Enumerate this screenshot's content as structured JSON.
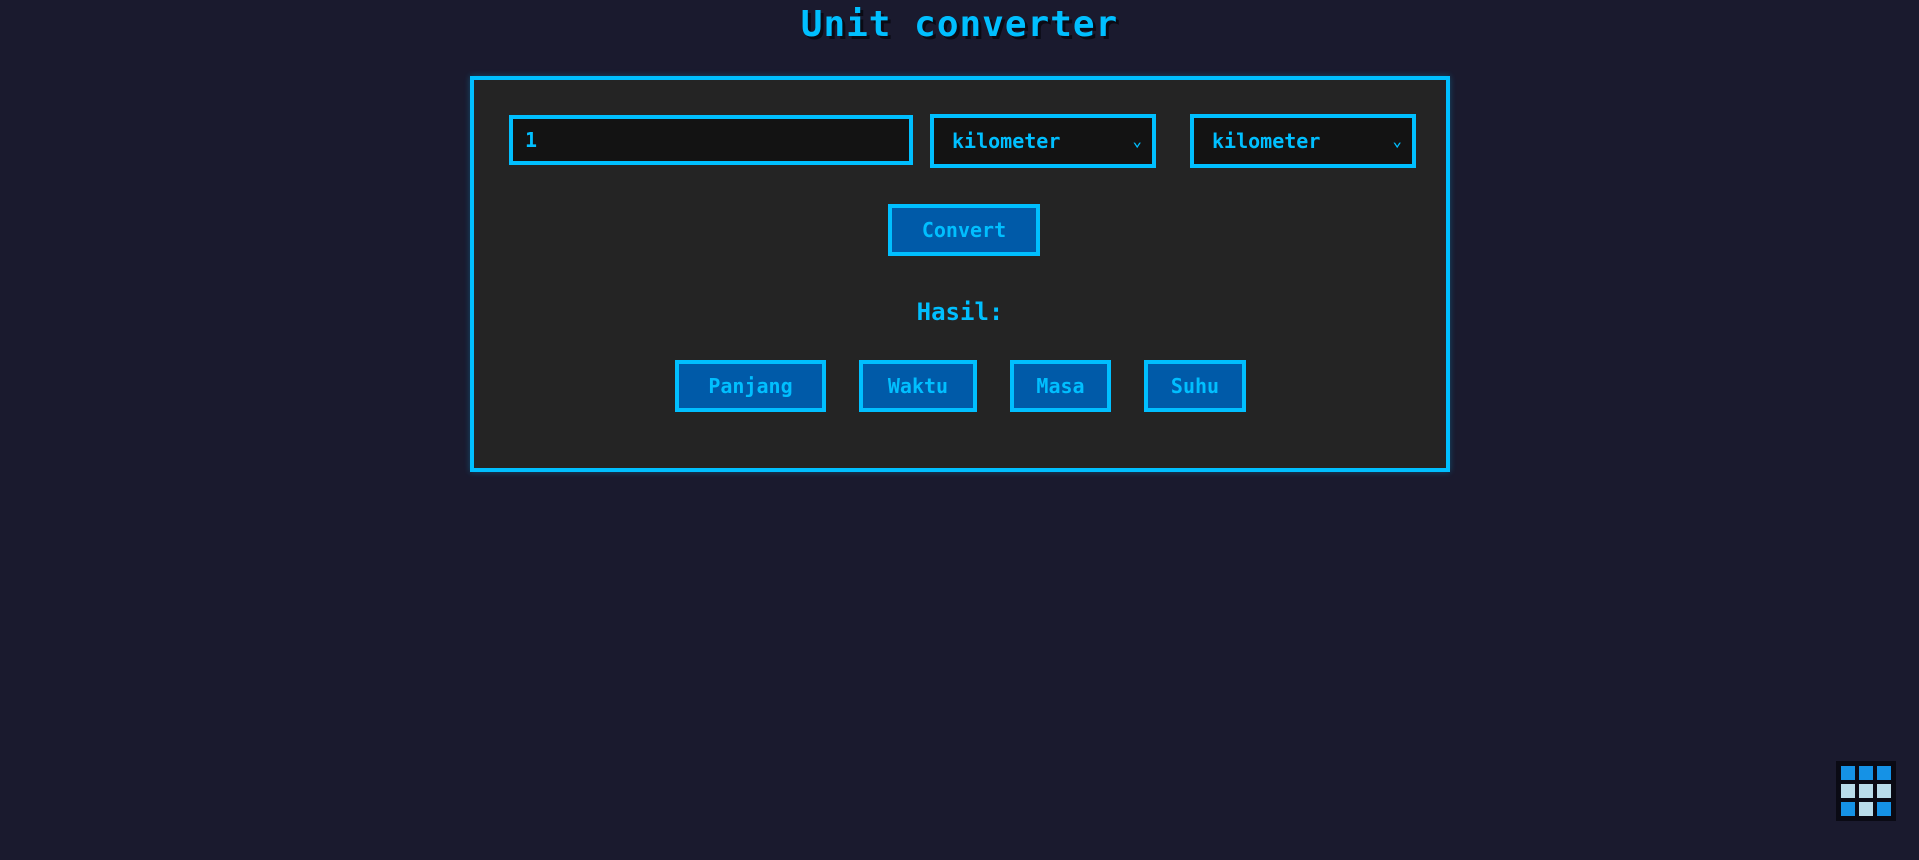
{
  "page": {
    "title": "Unit converter"
  },
  "converter": {
    "input_value": "1",
    "from_unit": "kilometer",
    "to_unit": "kilometer",
    "convert_label": "Convert",
    "result_label": "Hasil:"
  },
  "categories": [
    {
      "label": "Panjang"
    },
    {
      "label": "Waktu"
    },
    {
      "label": "Masa"
    },
    {
      "label": "Suhu"
    }
  ],
  "icons": {
    "select_chevron": "chevron-down-icon",
    "corner_widget": "grid-icon"
  },
  "colors": {
    "background": "#1a1a2e",
    "panel": "#242424",
    "accent": "#00bfff",
    "button": "#005aa8"
  }
}
